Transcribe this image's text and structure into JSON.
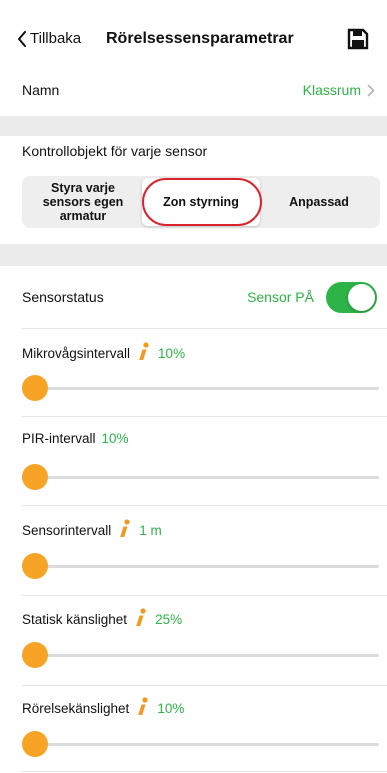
{
  "nav": {
    "back_label": "Tillbaka",
    "title": "Rörelsessensparametrar",
    "save_icon": "floppy-disk-icon"
  },
  "name_row": {
    "label": "Namn",
    "value": "Klassrum"
  },
  "control": {
    "section_title": "Kontrollobjekt för varje sensor",
    "options": [
      "Styra varje sensors egen armatur",
      "Zon styrning",
      "Anpassad"
    ],
    "selected": "Zon styrning"
  },
  "sensor_status": {
    "label": "Sensorstatus",
    "status_text": "Sensor PÅ",
    "enabled": true
  },
  "params": [
    {
      "label": "Mikrovågsintervall",
      "has_info": true,
      "value": "10%",
      "slider_level": 0.0
    },
    {
      "label": "PIR-intervall",
      "has_info": false,
      "value": "10%",
      "slider_level": 0.0
    },
    {
      "label": "Sensorintervall",
      "has_info": true,
      "value": "1 m",
      "slider_level": 0.0
    },
    {
      "label": "Statisk känslighet",
      "has_info": true,
      "value": "25%",
      "slider_level": 0.0
    },
    {
      "label": "Rörelsekänslighet",
      "has_info": true,
      "value": "10%",
      "slider_level": 0.0
    }
  ],
  "colors": {
    "accent_green": "#2db347",
    "slider_orange": "#f7a325",
    "info_orange": "#f39a1e",
    "highlight_red": "#d9232c"
  }
}
